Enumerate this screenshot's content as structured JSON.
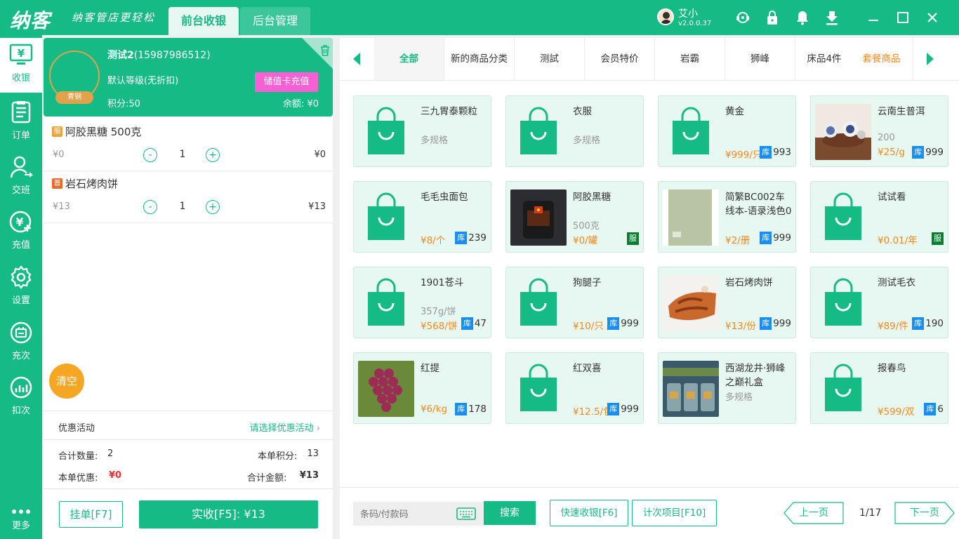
{
  "topbar": {
    "logo": "纳客",
    "slogan": "纳客管店更轻松",
    "tabs": [
      "前台收银",
      "后台管理"
    ],
    "user_name": "艾小",
    "version": "v2.0.0.37"
  },
  "sidebar": [
    {
      "label": "收银",
      "icon": "cashier-icon"
    },
    {
      "label": "订单",
      "icon": "order-icon"
    },
    {
      "label": "交班",
      "icon": "handover-icon"
    },
    {
      "label": "充值",
      "icon": "recharge-icon"
    },
    {
      "label": "设置",
      "icon": "settings-icon"
    },
    {
      "label": "充次",
      "icon": "times-recharge-icon"
    },
    {
      "label": "扣次",
      "icon": "deduct-times-icon"
    },
    {
      "label": "更多",
      "icon": "more-icon"
    }
  ],
  "member": {
    "name": "测试2",
    "phone": "(15987986512)",
    "badge": "青铜",
    "level": "默认等级(无折扣)",
    "points": "积分:50",
    "recharge_label": "储值卡充值",
    "balance": "余额: ¥0"
  },
  "cart": [
    {
      "tag": "服",
      "tag_color": "#e8a33a",
      "name": "阿胶黑糖 500克",
      "price": "¥0",
      "qty": "1",
      "subtotal": "¥0"
    },
    {
      "tag": "普",
      "tag_color": "#f06a27",
      "name": "岩石烤肉饼",
      "price": "¥13",
      "qty": "1",
      "subtotal": "¥13"
    }
  ],
  "cart_controls": {
    "minus": "-",
    "plus": "+"
  },
  "clear_label": "清空",
  "promo": {
    "label": "优惠活动",
    "select": "请选择优惠活动"
  },
  "summary": {
    "qty_label": "合计数量:",
    "qty": "2",
    "points_label": "本单积分:",
    "points": "13",
    "discount_label": "本单优惠:",
    "discount": "¥0",
    "total_label": "合计金额:",
    "total": "¥13"
  },
  "actions": {
    "hang": "挂单[F7]",
    "pay": "实收[F5]: ¥13"
  },
  "categories": [
    "全部",
    "新的商品分类",
    "测試",
    "会员特价",
    "岩霸",
    "狮峰",
    "床品4件",
    "套餐商品"
  ],
  "products": [
    {
      "name": "三九胃泰颗粒",
      "spec": "多规格",
      "price": "",
      "stock": "",
      "img": "bag"
    },
    {
      "name": "衣服",
      "spec": "多规格",
      "price": "",
      "stock": "",
      "img": "bag"
    },
    {
      "name": "黄金",
      "spec": "",
      "price": "¥999/只",
      "stock": "993",
      "img": "bag"
    },
    {
      "name": "云南生普洱",
      "spec": "200",
      "price": "¥25/g",
      "stock": "999",
      "img": "tea"
    },
    {
      "name": "毛毛虫面包",
      "spec": "",
      "price": "¥8/个",
      "stock": "239",
      "img": "bag"
    },
    {
      "name": "阿胶黑糖",
      "spec": "500克",
      "price": "¥0/罐",
      "stock": "",
      "tag": "服",
      "img": "jar"
    },
    {
      "name": "简繁BC002车线本-语录浅色0",
      "spec": "",
      "price": "¥2/册",
      "stock": "999",
      "img": "book"
    },
    {
      "name": "试试看",
      "spec": "",
      "price": "¥0.01/年",
      "stock": "",
      "tag": "服",
      "img": "bag"
    },
    {
      "name": "1901苍斗",
      "spec": "357g/饼",
      "price": "¥568/饼",
      "stock": "47",
      "img": "bag"
    },
    {
      "name": "狗腿子",
      "spec": "",
      "price": "¥10/只",
      "stock": "999",
      "img": "bag"
    },
    {
      "name": "岩石烤肉饼",
      "spec": "",
      "price": "¥13/份",
      "stock": "999",
      "img": "meat"
    },
    {
      "name": "测试毛衣",
      "spec": "",
      "price": "¥89/件",
      "stock": "190",
      "img": "bag"
    },
    {
      "name": "红提",
      "spec": "",
      "price": "¥6/kg",
      "stock": "178",
      "img": "grape"
    },
    {
      "name": "红双喜",
      "spec": "",
      "price": "¥12.5/包",
      "stock": "999",
      "img": "bag"
    },
    {
      "name": "西湖龙井·狮峰之巅礼盒",
      "spec": "多规格",
      "price": "",
      "stock": "",
      "img": "giftbox"
    },
    {
      "name": "报春鸟",
      "spec": "",
      "price": "¥599/双",
      "stock": "6",
      "img": "bag"
    }
  ],
  "stock_tag": "库",
  "bottom": {
    "search_placeholder": "条码/付款码",
    "search_btn": "搜索",
    "quick_btn": "快速收银[F6]",
    "times_btn": "计次项目[F10]",
    "prev": "上一页",
    "page": "1/17",
    "next": "下一页"
  },
  "colors": {
    "primary": "#16ba85",
    "price": "#f5891f",
    "stock_badge": "#1a8ef0",
    "pink": "#f760d4",
    "clear": "#f5a623"
  }
}
